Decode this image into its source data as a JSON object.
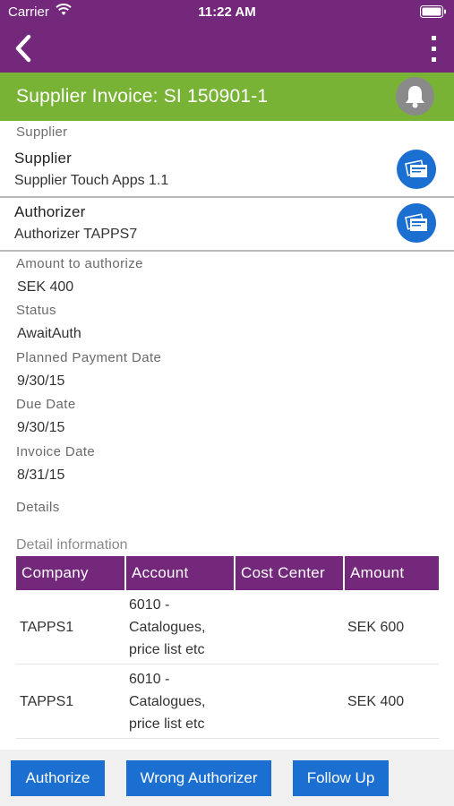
{
  "status_bar": {
    "carrier": "Carrier",
    "time": "11:22 AM"
  },
  "header": {
    "title": "Supplier Invoice: SI 150901-1"
  },
  "supplier": {
    "section_label": "Supplier",
    "title": "Supplier",
    "value": "Supplier Touch Apps 1.1"
  },
  "authorizer": {
    "title": "Authorizer",
    "value": "Authorizer TAPPS7"
  },
  "fields": [
    {
      "label": "Amount to authorize",
      "value": "SEK 400"
    },
    {
      "label": "Status",
      "value": "AwaitAuth"
    },
    {
      "label": "Planned Payment Date",
      "value": "9/30/15"
    },
    {
      "label": "Due Date",
      "value": "9/30/15"
    },
    {
      "label": "Invoice Date",
      "value": "8/31/15"
    }
  ],
  "details_label": "Details",
  "detail_info_label": "Detail information",
  "table": {
    "columns": [
      "Company",
      "Account",
      "Cost Center",
      "Amount"
    ],
    "rows": [
      {
        "company": "TAPPS1",
        "account": "6010 - Catalogues, price list etc",
        "cost_center": "",
        "amount": "SEK 600"
      },
      {
        "company": "TAPPS1",
        "account": "6010 - Catalogues, price list etc",
        "cost_center": "",
        "amount": "SEK 400"
      }
    ]
  },
  "footer": {
    "authorize": "Authorize",
    "wrong_authorizer": "Wrong Authorizer",
    "follow_up": "Follow Up"
  },
  "icons": {
    "back": "chevron-left-icon",
    "menu": "more-vertical-icon",
    "bell": "bell-icon",
    "card": "contact-card-icon"
  },
  "colors": {
    "primary": "#74287c",
    "header_green": "#79b336",
    "button_blue": "#1b6fd1",
    "bell_gray": "#8a8a8a"
  }
}
